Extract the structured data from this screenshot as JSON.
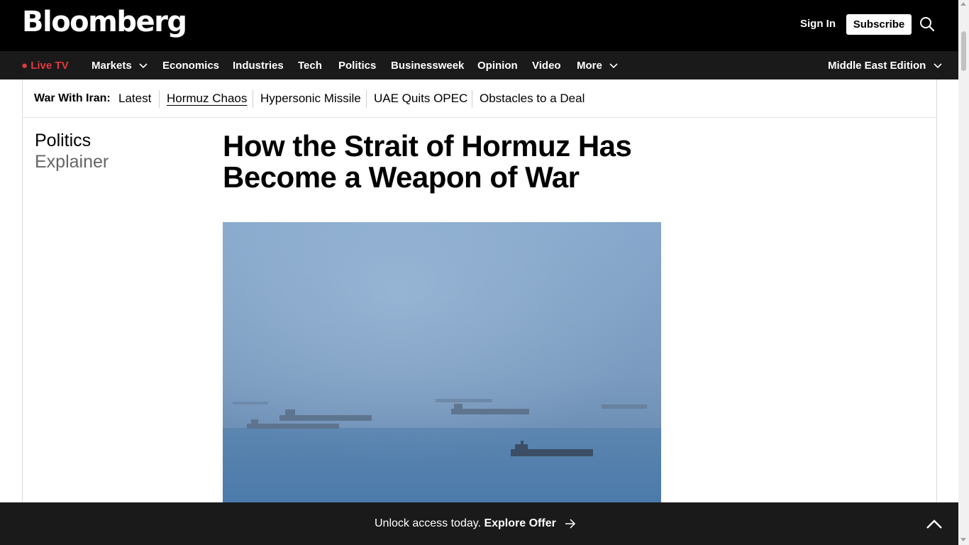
{
  "header": {
    "logo": "Bloomberg",
    "sign_in": "Sign In",
    "subscribe": "Subscribe",
    "search_icon": "search-icon"
  },
  "nav": {
    "live": "● Live TV",
    "items": [
      "Markets",
      "Economics",
      "Industries",
      "Tech",
      "Politics",
      "Businessweek",
      "Opinion",
      "Video",
      "More"
    ],
    "edition": "Middle East Edition"
  },
  "subnav": {
    "title": "War With Iran:",
    "links": [
      "Latest",
      "Hormuz Chaos",
      "Hypersonic Missile",
      "UAE Quits OPEC",
      "Obstacles to a Deal"
    ],
    "active_link": "Hormuz Chaos"
  },
  "article": {
    "category": "Politics",
    "subcategory": "Explainer",
    "headline": "How the Strait of Hormuz Has Become a Weapon of War",
    "image_subject": "Ships in hazy waters of the Strait of Hormuz"
  },
  "banner": {
    "text": "Unlock access today.",
    "cta": "Explore Offer"
  },
  "colors": {
    "live_red": "#e2383f",
    "topbar": "#000000",
    "navbar": "#1a1a1a"
  }
}
